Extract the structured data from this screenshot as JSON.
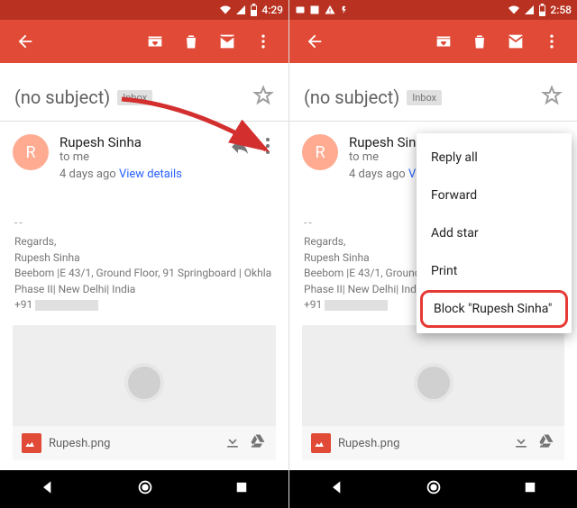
{
  "status": {
    "time_left": "4:29",
    "time_right": "2:58"
  },
  "subject": {
    "text": "(no subject)",
    "label": "Inbox"
  },
  "sender": {
    "initial": "R",
    "name": "Rupesh Sinha",
    "to": "to me",
    "time": "4 days ago",
    "details": "View details"
  },
  "body": {
    "regards": "Regards,",
    "sig_name": "Rupesh Sinha",
    "addr1_full": "Beebom |E 43/1, Ground Floor, 91 Springboard | Okhla Phase II| New Delhi| India",
    "addr1_short": "Beebom |E 43/1, Ground Floor,",
    "addr2_short": "Phase II| New Delhi| India",
    "phone_prefix": "+91"
  },
  "attachment": {
    "name": "Rupesh.png"
  },
  "menu": {
    "reply_all": "Reply all",
    "forward": "Forward",
    "add_star": "Add star",
    "print": "Print",
    "block": "Block \"Rupesh Sinha\""
  }
}
